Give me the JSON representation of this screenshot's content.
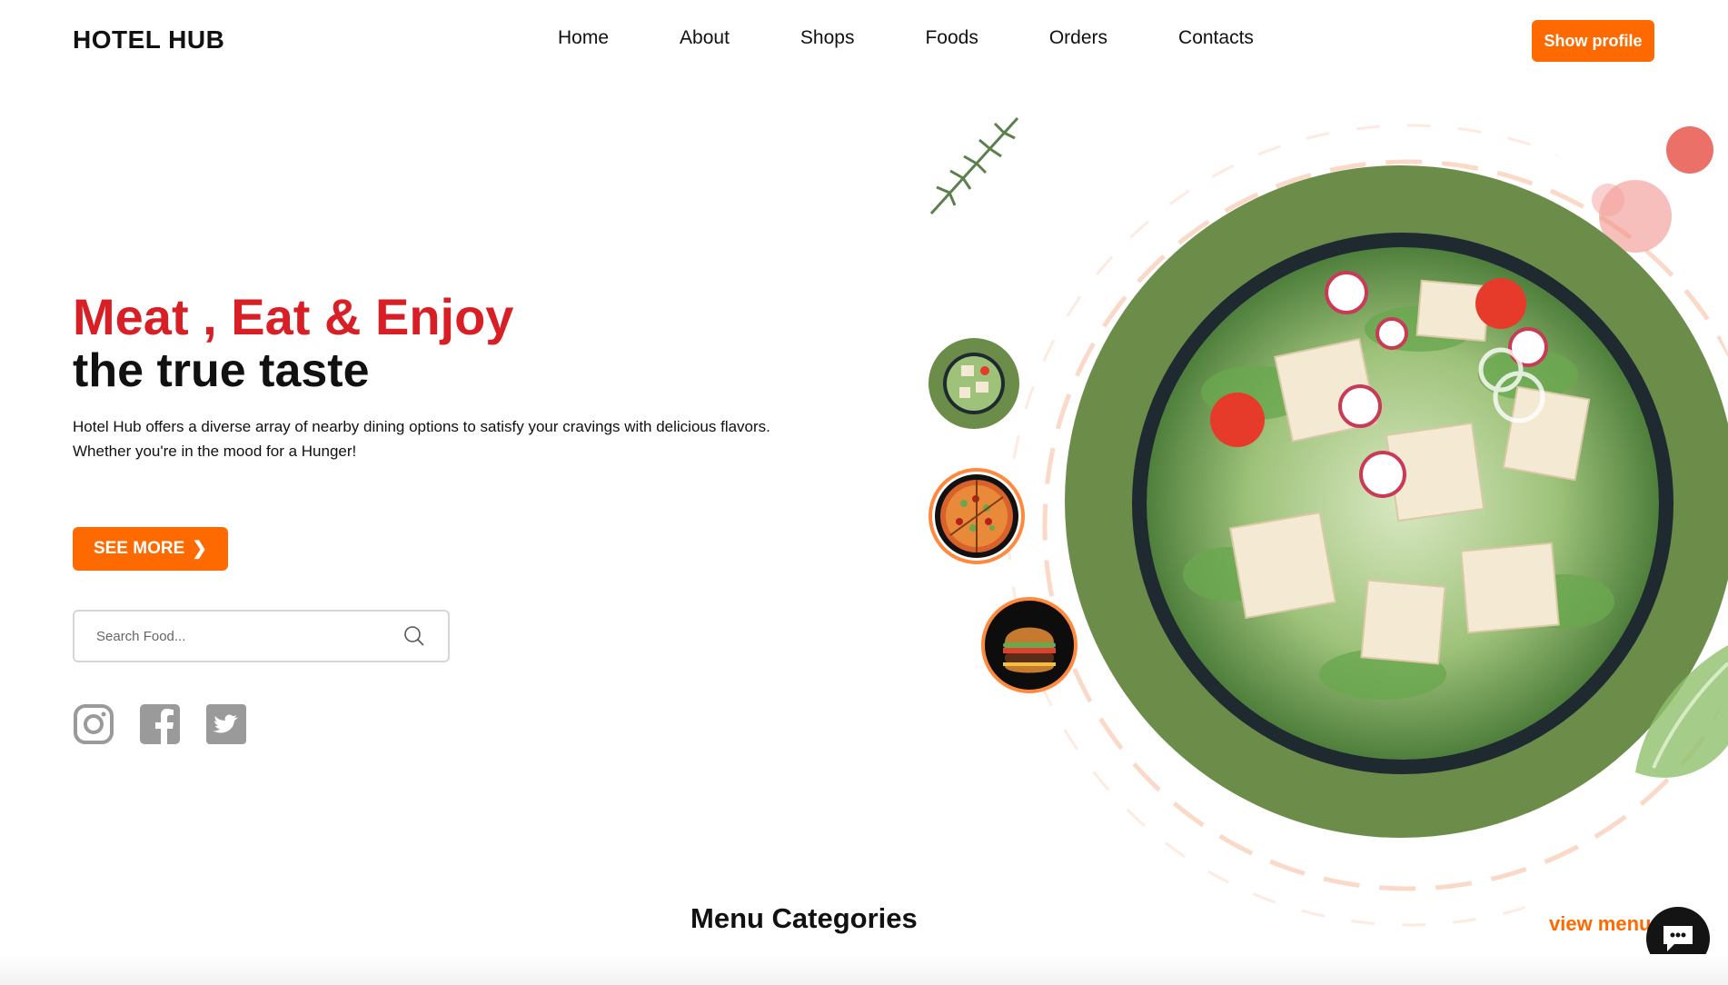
{
  "brand": "HOTEL HUB",
  "nav": {
    "items": [
      "Home",
      "About",
      "Shops",
      "Foods",
      "Orders",
      "Contacts"
    ]
  },
  "header": {
    "profile_button": "Show profile"
  },
  "hero": {
    "headline_red": "Meat , Eat & Enjoy",
    "headline_black": "the true taste",
    "description": "Hotel Hub offers a diverse array of nearby dining options to satisfy your cravings with delicious flavors. Whether you're in the mood for a Hunger!",
    "cta_label": "SEE MORE"
  },
  "search": {
    "placeholder": "Search Food...",
    "value": ""
  },
  "social": [
    "instagram-icon",
    "facebook-icon",
    "twitter-icon"
  ],
  "thumbnails": [
    "salad",
    "pizza",
    "burger"
  ],
  "menu_section": {
    "title": "Menu Categories",
    "view_menu": "view menu"
  },
  "colors": {
    "accent": "#ff6a00",
    "headline_red": "#d91f26",
    "plate_green": "#6c8d4a",
    "ring_peach": "#fbd9c8",
    "icon_gray": "#9a9a9a"
  }
}
